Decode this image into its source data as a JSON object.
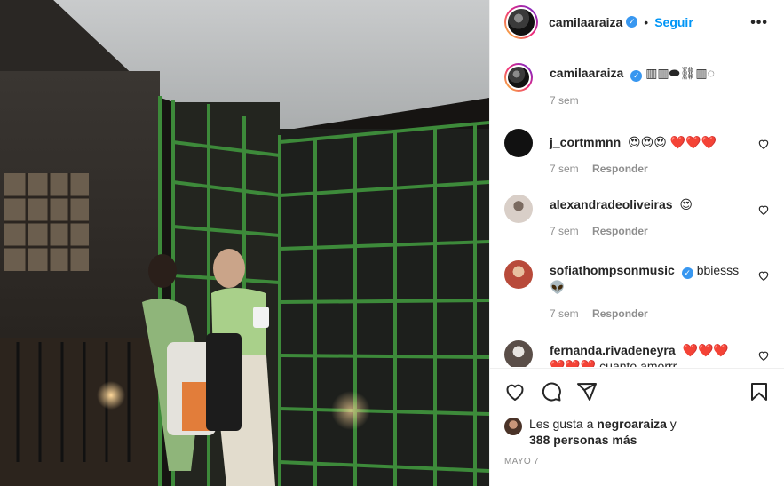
{
  "post": {
    "author": "camilaaraiza",
    "follow_label": "Seguir",
    "more_glyph": "•••",
    "dot": "•",
    "caption_emojis": "▥▥⬬⛓▥◌",
    "caption_time": "7 sem"
  },
  "comments": [
    {
      "user": "j_cortmmnn",
      "text": "😍😍😍 ❤️❤️❤️",
      "time": "7 sem",
      "reply": "Responder",
      "avatar_color": "#111111"
    },
    {
      "user": "alexandradeoliveiras",
      "text": "😍",
      "time": "7 sem",
      "reply": "Responder",
      "avatar_color": "#d9cfc8"
    },
    {
      "user": "sofiathompsonmusic",
      "text": "bbiesss",
      "text2": "👽",
      "time": "7 sem",
      "reply": "Responder",
      "avatar_color": "#b84a3a"
    },
    {
      "user": "fernanda.rivadeneyra",
      "text": "❤️❤️❤️",
      "text2": "❤️❤️❤️ cuanto amorrr",
      "avatar_color": "#5a4e48"
    }
  ],
  "likes": {
    "prefix": "Les gusta a",
    "user": "negroaraiza",
    "joiner": "y",
    "others": "388 personas más"
  },
  "date": "MAYO 7",
  "icons": {
    "verified": "✓",
    "like": "heart-icon",
    "comment": "comment-icon",
    "share": "share-icon",
    "save": "bookmark-icon"
  }
}
